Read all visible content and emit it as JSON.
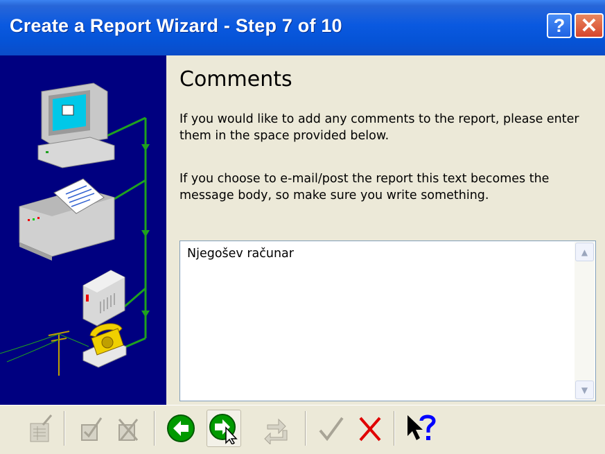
{
  "window": {
    "title": "Create a Report Wizard - Step 7 of 10",
    "help_glyph": "?",
    "close_glyph": "✕"
  },
  "content": {
    "heading": "Comments",
    "paragraph1": "If you would like to add any comments to the report, please enter them in the space provided below.",
    "paragraph2": "If you choose to e-mail/post the report this text becomes the message body, so make sure you write something.",
    "comments_value": "Njegošev računar"
  },
  "scrollbar": {
    "up_glyph": "▲",
    "down_glyph": "▼"
  },
  "toolbar": {
    "buttons": [
      {
        "icon": "edit-report-icon",
        "enabled": false
      },
      {
        "icon": "check-box-icon",
        "enabled": false
      },
      {
        "icon": "uncheck-box-icon",
        "enabled": false
      },
      {
        "icon": "back-arrow-icon",
        "enabled": true
      },
      {
        "icon": "next-arrow-icon",
        "enabled": true,
        "pressed": true
      },
      {
        "icon": "redo-icon",
        "enabled": false
      },
      {
        "icon": "checkmark-icon",
        "enabled": false
      },
      {
        "icon": "cancel-x-icon",
        "enabled": true
      },
      {
        "icon": "context-help-icon",
        "enabled": true
      }
    ]
  },
  "colors": {
    "titlebar": "#0553D6",
    "side_panel": "#000080",
    "window_bg": "#ECE9D8",
    "nav_green": "#00A000",
    "cancel_red": "#E00000",
    "help_blue": "#0000FF"
  }
}
